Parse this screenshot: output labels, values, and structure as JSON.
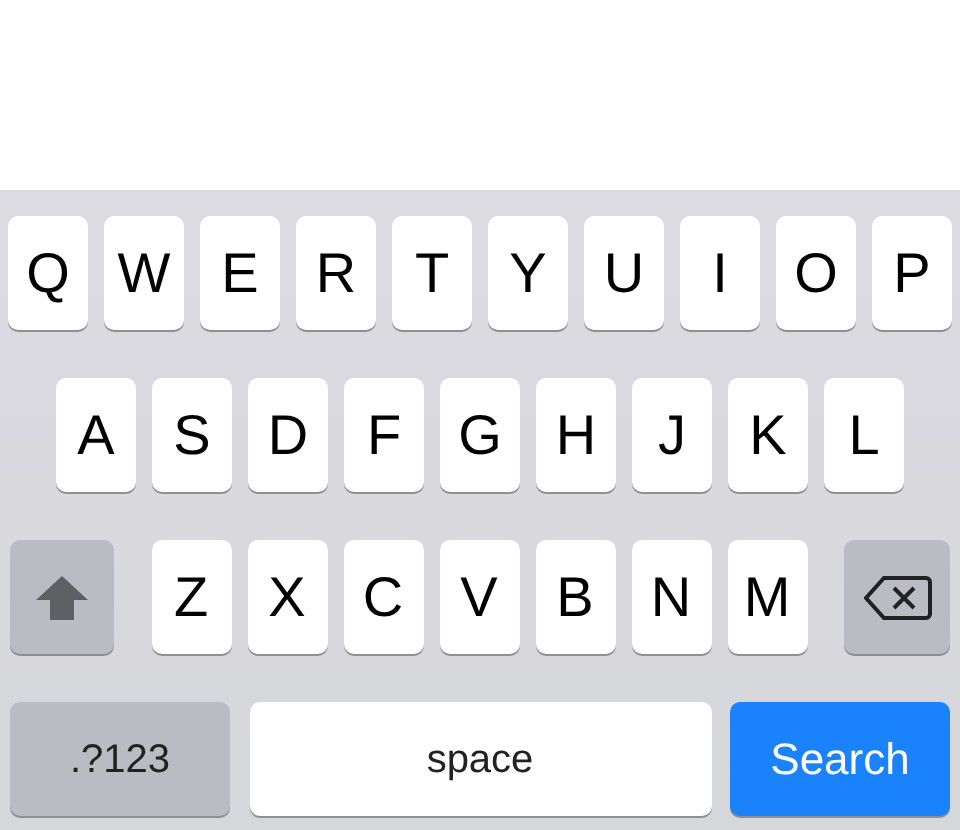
{
  "keyboard": {
    "rows": [
      {
        "keys": [
          {
            "kind": "letter",
            "label": "Q"
          },
          {
            "kind": "letter",
            "label": "W"
          },
          {
            "kind": "letter",
            "label": "E"
          },
          {
            "kind": "letter",
            "label": "R"
          },
          {
            "kind": "letter",
            "label": "T"
          },
          {
            "kind": "letter",
            "label": "Y"
          },
          {
            "kind": "letter",
            "label": "U"
          },
          {
            "kind": "letter",
            "label": "I"
          },
          {
            "kind": "letter",
            "label": "O"
          },
          {
            "kind": "letter",
            "label": "P"
          }
        ]
      },
      {
        "keys": [
          {
            "kind": "letter",
            "label": "A"
          },
          {
            "kind": "letter",
            "label": "S"
          },
          {
            "kind": "letter",
            "label": "D"
          },
          {
            "kind": "letter",
            "label": "F"
          },
          {
            "kind": "letter",
            "label": "G"
          },
          {
            "kind": "letter",
            "label": "H"
          },
          {
            "kind": "letter",
            "label": "J"
          },
          {
            "kind": "letter",
            "label": "K"
          },
          {
            "kind": "letter",
            "label": "L"
          }
        ]
      },
      {
        "keys": [
          {
            "kind": "shift",
            "on": false
          },
          {
            "kind": "letter",
            "label": "Z"
          },
          {
            "kind": "letter",
            "label": "X"
          },
          {
            "kind": "letter",
            "label": "C"
          },
          {
            "kind": "letter",
            "label": "V"
          },
          {
            "kind": "letter",
            "label": "B"
          },
          {
            "kind": "letter",
            "label": "N"
          },
          {
            "kind": "letter",
            "label": "M"
          },
          {
            "kind": "delete"
          }
        ]
      },
      {
        "keys": [
          {
            "kind": "mode",
            "label": ".?123"
          },
          {
            "kind": "space",
            "label": "space"
          },
          {
            "kind": "action",
            "label": "Search"
          }
        ]
      }
    ]
  }
}
